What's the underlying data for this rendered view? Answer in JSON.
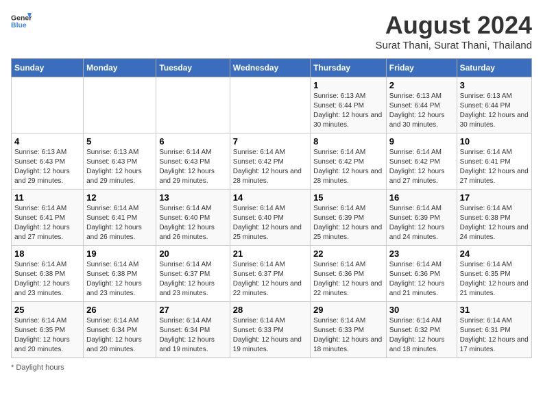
{
  "header": {
    "logo_general": "General",
    "logo_blue": "Blue",
    "title": "August 2024",
    "subtitle": "Surat Thani, Surat Thani, Thailand"
  },
  "weekdays": [
    "Sunday",
    "Monday",
    "Tuesday",
    "Wednesday",
    "Thursday",
    "Friday",
    "Saturday"
  ],
  "weeks": [
    [
      {
        "day": "",
        "sunrise": "",
        "sunset": "",
        "daylight": ""
      },
      {
        "day": "",
        "sunrise": "",
        "sunset": "",
        "daylight": ""
      },
      {
        "day": "",
        "sunrise": "",
        "sunset": "",
        "daylight": ""
      },
      {
        "day": "",
        "sunrise": "",
        "sunset": "",
        "daylight": ""
      },
      {
        "day": "1",
        "sunrise": "Sunrise: 6:13 AM",
        "sunset": "Sunset: 6:44 PM",
        "daylight": "Daylight: 12 hours and 30 minutes."
      },
      {
        "day": "2",
        "sunrise": "Sunrise: 6:13 AM",
        "sunset": "Sunset: 6:44 PM",
        "daylight": "Daylight: 12 hours and 30 minutes."
      },
      {
        "day": "3",
        "sunrise": "Sunrise: 6:13 AM",
        "sunset": "Sunset: 6:44 PM",
        "daylight": "Daylight: 12 hours and 30 minutes."
      }
    ],
    [
      {
        "day": "4",
        "sunrise": "Sunrise: 6:13 AM",
        "sunset": "Sunset: 6:43 PM",
        "daylight": "Daylight: 12 hours and 29 minutes."
      },
      {
        "day": "5",
        "sunrise": "Sunrise: 6:13 AM",
        "sunset": "Sunset: 6:43 PM",
        "daylight": "Daylight: 12 hours and 29 minutes."
      },
      {
        "day": "6",
        "sunrise": "Sunrise: 6:14 AM",
        "sunset": "Sunset: 6:43 PM",
        "daylight": "Daylight: 12 hours and 29 minutes."
      },
      {
        "day": "7",
        "sunrise": "Sunrise: 6:14 AM",
        "sunset": "Sunset: 6:42 PM",
        "daylight": "Daylight: 12 hours and 28 minutes."
      },
      {
        "day": "8",
        "sunrise": "Sunrise: 6:14 AM",
        "sunset": "Sunset: 6:42 PM",
        "daylight": "Daylight: 12 hours and 28 minutes."
      },
      {
        "day": "9",
        "sunrise": "Sunrise: 6:14 AM",
        "sunset": "Sunset: 6:42 PM",
        "daylight": "Daylight: 12 hours and 27 minutes."
      },
      {
        "day": "10",
        "sunrise": "Sunrise: 6:14 AM",
        "sunset": "Sunset: 6:41 PM",
        "daylight": "Daylight: 12 hours and 27 minutes."
      }
    ],
    [
      {
        "day": "11",
        "sunrise": "Sunrise: 6:14 AM",
        "sunset": "Sunset: 6:41 PM",
        "daylight": "Daylight: 12 hours and 27 minutes."
      },
      {
        "day": "12",
        "sunrise": "Sunrise: 6:14 AM",
        "sunset": "Sunset: 6:41 PM",
        "daylight": "Daylight: 12 hours and 26 minutes."
      },
      {
        "day": "13",
        "sunrise": "Sunrise: 6:14 AM",
        "sunset": "Sunset: 6:40 PM",
        "daylight": "Daylight: 12 hours and 26 minutes."
      },
      {
        "day": "14",
        "sunrise": "Sunrise: 6:14 AM",
        "sunset": "Sunset: 6:40 PM",
        "daylight": "Daylight: 12 hours and 25 minutes."
      },
      {
        "day": "15",
        "sunrise": "Sunrise: 6:14 AM",
        "sunset": "Sunset: 6:39 PM",
        "daylight": "Daylight: 12 hours and 25 minutes."
      },
      {
        "day": "16",
        "sunrise": "Sunrise: 6:14 AM",
        "sunset": "Sunset: 6:39 PM",
        "daylight": "Daylight: 12 hours and 24 minutes."
      },
      {
        "day": "17",
        "sunrise": "Sunrise: 6:14 AM",
        "sunset": "Sunset: 6:38 PM",
        "daylight": "Daylight: 12 hours and 24 minutes."
      }
    ],
    [
      {
        "day": "18",
        "sunrise": "Sunrise: 6:14 AM",
        "sunset": "Sunset: 6:38 PM",
        "daylight": "Daylight: 12 hours and 23 minutes."
      },
      {
        "day": "19",
        "sunrise": "Sunrise: 6:14 AM",
        "sunset": "Sunset: 6:38 PM",
        "daylight": "Daylight: 12 hours and 23 minutes."
      },
      {
        "day": "20",
        "sunrise": "Sunrise: 6:14 AM",
        "sunset": "Sunset: 6:37 PM",
        "daylight": "Daylight: 12 hours and 23 minutes."
      },
      {
        "day": "21",
        "sunrise": "Sunrise: 6:14 AM",
        "sunset": "Sunset: 6:37 PM",
        "daylight": "Daylight: 12 hours and 22 minutes."
      },
      {
        "day": "22",
        "sunrise": "Sunrise: 6:14 AM",
        "sunset": "Sunset: 6:36 PM",
        "daylight": "Daylight: 12 hours and 22 minutes."
      },
      {
        "day": "23",
        "sunrise": "Sunrise: 6:14 AM",
        "sunset": "Sunset: 6:36 PM",
        "daylight": "Daylight: 12 hours and 21 minutes."
      },
      {
        "day": "24",
        "sunrise": "Sunrise: 6:14 AM",
        "sunset": "Sunset: 6:35 PM",
        "daylight": "Daylight: 12 hours and 21 minutes."
      }
    ],
    [
      {
        "day": "25",
        "sunrise": "Sunrise: 6:14 AM",
        "sunset": "Sunset: 6:35 PM",
        "daylight": "Daylight: 12 hours and 20 minutes."
      },
      {
        "day": "26",
        "sunrise": "Sunrise: 6:14 AM",
        "sunset": "Sunset: 6:34 PM",
        "daylight": "Daylight: 12 hours and 20 minutes."
      },
      {
        "day": "27",
        "sunrise": "Sunrise: 6:14 AM",
        "sunset": "Sunset: 6:34 PM",
        "daylight": "Daylight: 12 hours and 19 minutes."
      },
      {
        "day": "28",
        "sunrise": "Sunrise: 6:14 AM",
        "sunset": "Sunset: 6:33 PM",
        "daylight": "Daylight: 12 hours and 19 minutes."
      },
      {
        "day": "29",
        "sunrise": "Sunrise: 6:14 AM",
        "sunset": "Sunset: 6:33 PM",
        "daylight": "Daylight: 12 hours and 18 minutes."
      },
      {
        "day": "30",
        "sunrise": "Sunrise: 6:14 AM",
        "sunset": "Sunset: 6:32 PM",
        "daylight": "Daylight: 12 hours and 18 minutes."
      },
      {
        "day": "31",
        "sunrise": "Sunrise: 6:14 AM",
        "sunset": "Sunset: 6:31 PM",
        "daylight": "Daylight: 12 hours and 17 minutes."
      }
    ]
  ],
  "footer": {
    "note": "Daylight hours"
  }
}
